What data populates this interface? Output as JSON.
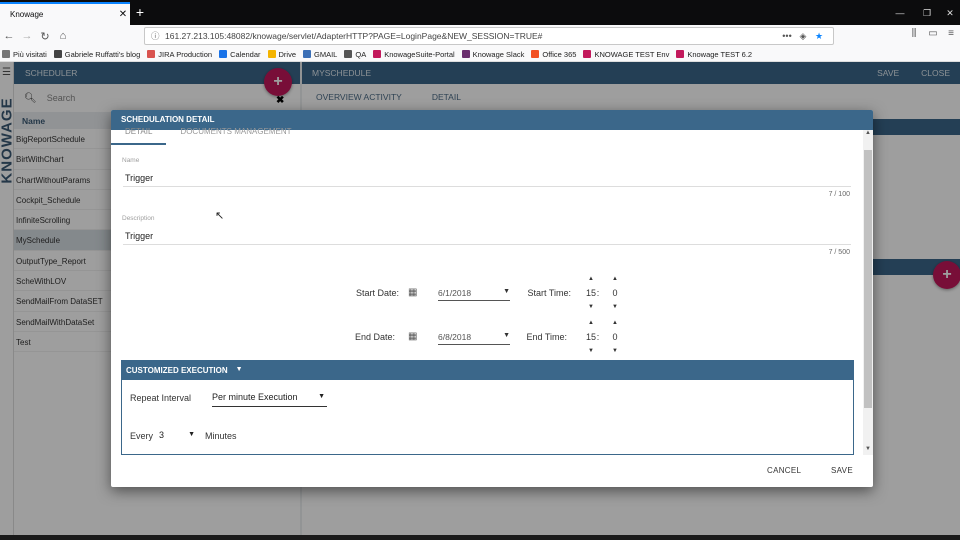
{
  "browser": {
    "tab_title": "Knowage",
    "tab_close": "✕",
    "new_tab": "+",
    "url": "161.27.213.105:48082/knowage/servlet/AdapterHTTP?PAGE=LoginPage&NEW_SESSION=TRUE#",
    "bookmarks": [
      {
        "label": "Più visitati",
        "color": "#777777"
      },
      {
        "label": "Gabriele Ruffatti's blog",
        "color": "#444444"
      },
      {
        "label": "JIRA Production",
        "color": "#d9534f"
      },
      {
        "label": "Calendar",
        "color": "#1a73e8"
      },
      {
        "label": "Drive",
        "color": "#f4b400"
      },
      {
        "label": "GMAIL",
        "color": "#3b6fb6"
      },
      {
        "label": "QA",
        "color": "#555555"
      },
      {
        "label": "KnowageSuite-Portal",
        "color": "#c2185b"
      },
      {
        "label": "Knowage Slack",
        "color": "#6b2f6e"
      },
      {
        "label": "Office 365",
        "color": "#f25022"
      },
      {
        "label": "KNOWAGE TEST Env",
        "color": "#c2185b"
      },
      {
        "label": "Knowage TEST 6.2",
        "color": "#c2185b"
      }
    ]
  },
  "app": {
    "brand": "KNOWAGE",
    "left_panel": {
      "title": "SCHEDULER",
      "search_placeholder": "Search",
      "column_header": "Name",
      "rows": [
        "BigReportSchedule",
        "BirtWithChart",
        "ChartWithoutParams",
        "Cockpit_Schedule",
        "InfiniteScrolling",
        "MySchedule",
        "OutputType_Report",
        "ScheWithLOV",
        "SendMailFrom DataSET",
        "SendMailWithDataSet",
        "Test"
      ],
      "selected_index": 5,
      "add_label": "+",
      "close_label": "✖"
    },
    "right_panel": {
      "title": "MYSCHEDULE",
      "save": "SAVE",
      "close": "CLOSE",
      "tabs": [
        "OVERVIEW ACTIVITY",
        "DETAIL"
      ],
      "add_label": "+"
    }
  },
  "dialog": {
    "title": "SCHEDULATION DETAIL",
    "tabs": [
      "DETAIL",
      "DOCUMENTS MANAGEMENT"
    ],
    "name_label": "Name",
    "name_value": "Trigger",
    "name_counter": "7 / 100",
    "description_label": "Description",
    "description_value": "Trigger",
    "description_counter": "7 / 500",
    "start_date_label": "Start Date:",
    "start_date_value": "6/1/2018",
    "start_time_label": "Start Time:",
    "start_hour": "15",
    "start_minute": "0",
    "end_date_label": "End Date:",
    "end_date_value": "6/8/2018",
    "end_time_label": "End Time:",
    "end_hour": "15",
    "end_minute": "0",
    "time_separator": ":",
    "customized_execution": {
      "title": "CUSTOMIZED EXECUTION",
      "repeat_label": "Repeat Interval",
      "repeat_value": "Per minute Execution",
      "every_label": "Every",
      "every_value": "3",
      "unit_label": "Minutes"
    },
    "cancel": "CANCEL",
    "save": "SAVE"
  },
  "colors": {
    "header_blue": "#3b678a",
    "accent_pink": "#c2185b"
  }
}
